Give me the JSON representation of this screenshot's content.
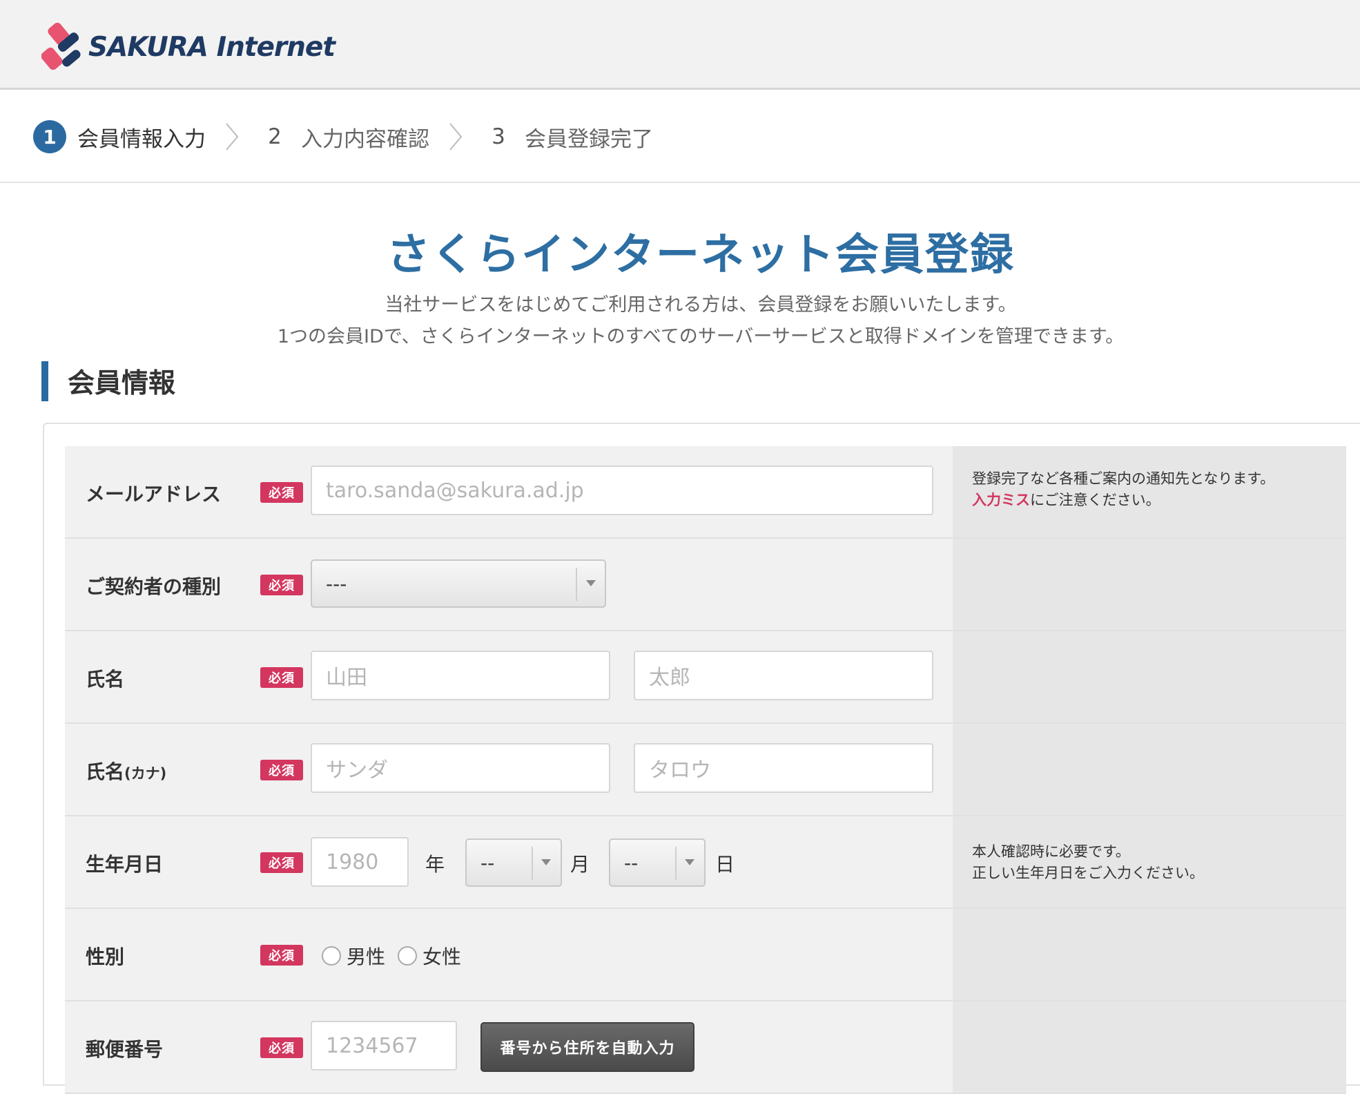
{
  "header": {
    "logo_text": "SAKURA Internet",
    "logo_colors": {
      "pink": "#e8546f",
      "navy": "#1f3a63"
    }
  },
  "steps": [
    {
      "num": "1",
      "label": "会員情報入力",
      "active": true
    },
    {
      "num": "2",
      "label": "入力内容確認",
      "active": false
    },
    {
      "num": "3",
      "label": "会員登録完了",
      "active": false
    }
  ],
  "page": {
    "title": "さくらインターネット会員登録",
    "subtitle1": "当社サービスをはじめてご利用される方は、会員登録をお願いいたします。",
    "subtitle2": "1つの会員IDで、さくらインターネットのすべてのサーバーサービスと取得ドメインを管理できます。",
    "section_title": "会員情報"
  },
  "form": {
    "required_badge": "必須",
    "email": {
      "label": "メールアドレス",
      "placeholder": "taro.sanda@sakura.ad.jp",
      "note_line1": "登録完了など各種ご案内の通知先となります。",
      "note_warn": "入力ミス",
      "note_line2_rest": "にご注意ください。"
    },
    "contract_type": {
      "label": "ご契約者の種別",
      "selected": "---"
    },
    "name": {
      "label": "氏名",
      "last_placeholder": "山田",
      "first_placeholder": "太郎"
    },
    "name_kana": {
      "label_main": "氏名",
      "label_small": "(カナ)",
      "last_placeholder": "サンダ",
      "first_placeholder": "タロウ"
    },
    "birthdate": {
      "label": "生年月日",
      "year_placeholder": "1980",
      "year_unit": "年",
      "month_selected": "--",
      "month_unit": "月",
      "day_selected": "--",
      "day_unit": "日",
      "note_line1": "本人確認時に必要です。",
      "note_line2": "正しい生年月日をご入力ください。"
    },
    "gender": {
      "label": "性別",
      "options": [
        "男性",
        "女性"
      ]
    },
    "postal": {
      "label": "郵便番号",
      "placeholder": "1234567",
      "autofill_button": "番号から住所を自動入力"
    }
  }
}
